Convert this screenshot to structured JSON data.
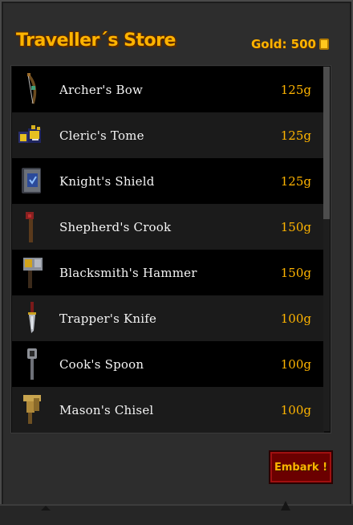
{
  "store": {
    "title": "Traveller´s Store",
    "gold_text": "Gold: 500",
    "embark_label": "Embark !"
  },
  "items": [
    {
      "name": "Archer's Bow",
      "price": "125g",
      "icon": "bow-icon"
    },
    {
      "name": "Cleric's Tome",
      "price": "125g",
      "icon": "tome-icon"
    },
    {
      "name": "Knight's Shield",
      "price": "125g",
      "icon": "shield-icon"
    },
    {
      "name": "Shepherd's Crook",
      "price": "150g",
      "icon": "crook-icon"
    },
    {
      "name": "Blacksmith's Hammer",
      "price": "150g",
      "icon": "hammer-icon"
    },
    {
      "name": "Trapper's Knife",
      "price": "100g",
      "icon": "knife-icon"
    },
    {
      "name": "Cook's Spoon",
      "price": "100g",
      "icon": "spoon-icon"
    },
    {
      "name": "Mason's Chisel",
      "price": "100g",
      "icon": "chisel-icon"
    }
  ],
  "colors": {
    "accent_gold": "#ffb400",
    "button_red": "#6b0000"
  }
}
